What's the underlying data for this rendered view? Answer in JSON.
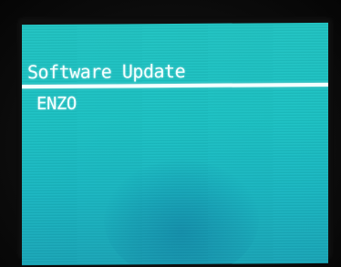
{
  "screen": {
    "title": "Software Update",
    "items": [
      {
        "label": "ENZO"
      }
    ]
  },
  "colors": {
    "background": "#1cc2c4",
    "text": "#f4ffff",
    "bezel": "#0f0f0f"
  }
}
